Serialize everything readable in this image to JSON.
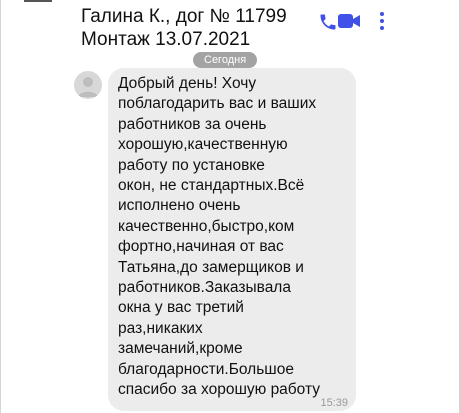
{
  "header": {
    "title_line1": "Галина К., дог № 11799",
    "title_line2": "Монтаж 13.07.2021",
    "icons": [
      "phone-icon",
      "video-call-icon",
      "more-vertical-icon"
    ],
    "accent_color": "#3f51e8"
  },
  "conversation": {
    "date_label": "Сегодня",
    "message": {
      "lines": [
        "Добрый день! Хочу",
        "поблагодарить вас и ваших",
        "работников за очень",
        "хорошую,качественную",
        "работу по установке",
        "окон, не стандартных.Всё",
        "исполнено очень",
        "качественно,быстро,ком",
        "фортно,начиная от вас",
        "Татьяна,до замерщиков и",
        "работников.Заказывала",
        "окна у вас третий",
        "раз,никаких",
        "замечаний,кроме",
        "благодарности.Большое",
        "спасибо за хорошую работу"
      ],
      "time": "15:39"
    }
  }
}
